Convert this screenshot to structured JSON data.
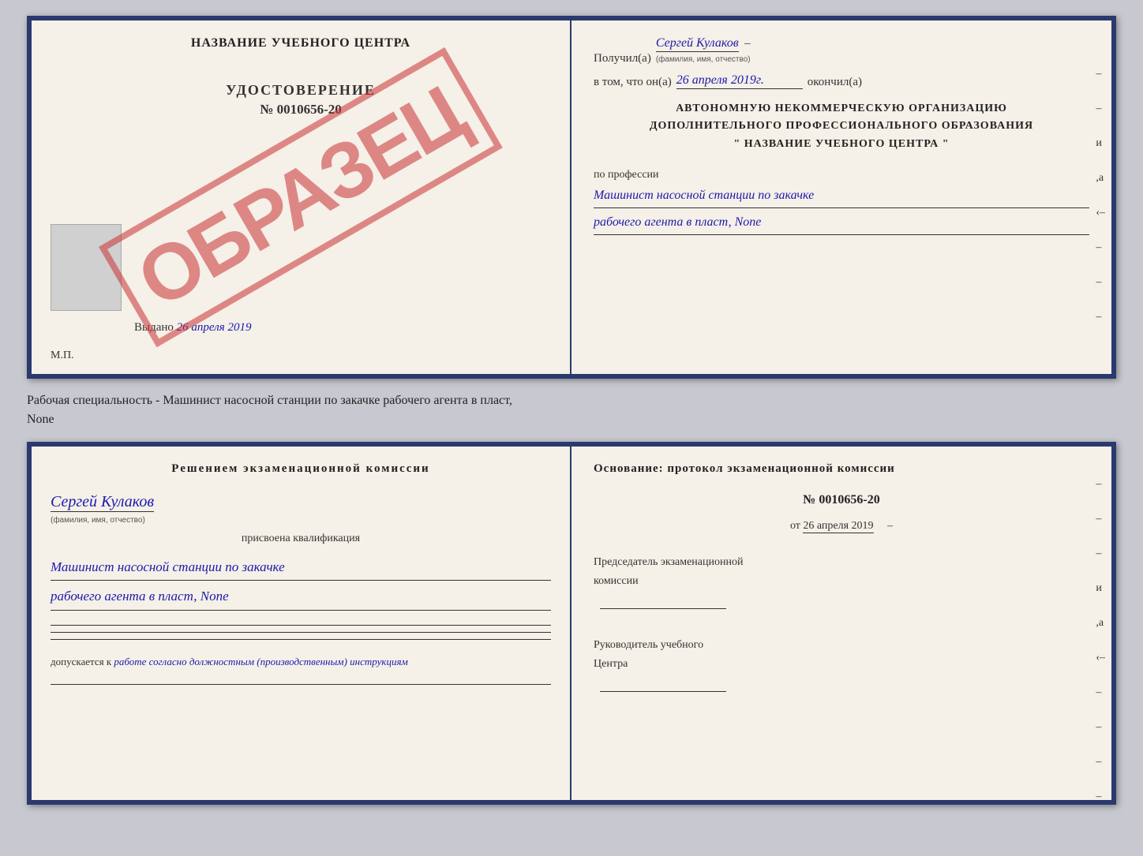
{
  "top_doc": {
    "left": {
      "title": "НАЗВАНИЕ УЧЕБНОГО ЦЕНТРА",
      "watermark": "ОБРАЗЕЦ",
      "udostoverenie": "УДОСТОВЕРЕНИЕ",
      "number": "№ 0010656-20",
      "vydano_label": "Выдано",
      "vydano_date": "26 апреля 2019",
      "mp": "М.П."
    },
    "right": {
      "received_label": "Получил(а)",
      "received_name": "Сергей Кулаков",
      "fio_sub": "(фамилия, имя, отчество)",
      "vtom_label": "в том, что он(а)",
      "vtom_date": "26 апреля 2019г.",
      "okончил_label": "окончил(а)",
      "org_line1": "АВТОНОМНУЮ НЕКОММЕРЧЕСКУЮ ОРГАНИЗАЦИЮ",
      "org_line2": "ДОПОЛНИТЕЛЬНОГО ПРОФЕССИОНАЛЬНОГО ОБРАЗОВАНИЯ",
      "org_quote": "\"    НАЗВАНИЕ УЧЕБНОГО ЦЕНТРА    \"",
      "po_professii": "по профессии",
      "profession1": "Машинист насосной станции по закачке",
      "profession2": "рабочего агента в пласт, None"
    }
  },
  "divider": {
    "text": "Рабочая специальность - Машинист насосной станции по закачке рабочего агента в пласт,",
    "text2": "None"
  },
  "bottom_doc": {
    "left": {
      "decision_title": "Решением  экзаменационной  комиссии",
      "name": "Сергей Кулаков",
      "fio_sub": "(фамилия, имя, отчество)",
      "assigned": "присвоена квалификация",
      "qualification1": "Машинист насосной станции по закачке",
      "qualification2": "рабочего агента в пласт, None",
      "допускается_label": "допускается к",
      "допускается_text": "работе согласно должностным (производственным) инструкциям"
    },
    "right": {
      "osnov_title": "Основание:  протокол  экзаменационной  комиссии",
      "protocol_number": "№  0010656-20",
      "protocol_date_prefix": "от",
      "protocol_date": "26 апреля 2019",
      "predsed_label": "Председатель экзаменационной",
      "komissii_label": "комиссии",
      "ruk_label": "Руководитель учебного",
      "centr_label": "Центра"
    }
  }
}
